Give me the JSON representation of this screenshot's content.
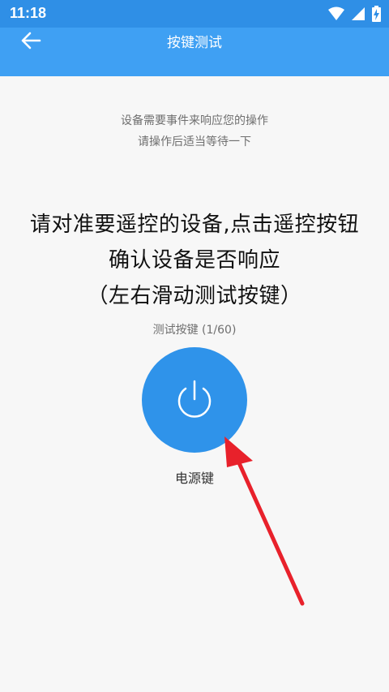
{
  "status_bar": {
    "time": "11:18",
    "icons": [
      "wifi-icon",
      "signal-icon",
      "battery-charging-icon"
    ]
  },
  "app_bar": {
    "title": "按键测试",
    "back_icon": "arrow-left-icon"
  },
  "hint": {
    "line1": "设备需要事件来响应您的操作",
    "line2": "请操作后适当等待一下"
  },
  "instructions": {
    "line1": "请对准要遥控的设备,点击遥控按钮",
    "line2": "确认设备是否响应",
    "line3": "（左右滑动测试按键）"
  },
  "test": {
    "progress_text": "测试按键 (1/60)",
    "button_icon": "power-icon",
    "key_name": "电源键"
  },
  "colors": {
    "status_bar": "#2f8fe6",
    "app_bar": "#3fa0f3",
    "power_button": "#2f93ea",
    "annotation_arrow": "#e8212b"
  }
}
